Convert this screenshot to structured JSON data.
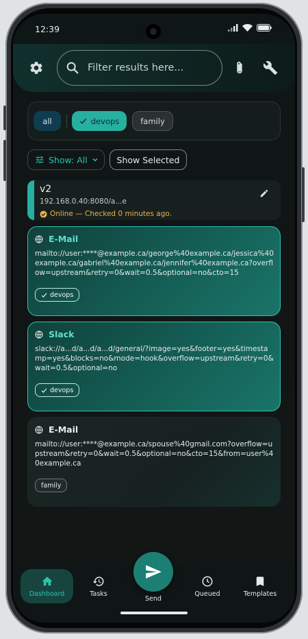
{
  "status_bar": {
    "time": "12:39"
  },
  "header": {
    "settings_icon": "gear-icon",
    "search": {
      "placeholder": "Filter results here...",
      "value": ""
    },
    "attach_icon": "paperclip-icon",
    "tools_icon": "wrench-icon"
  },
  "tag_filters": [
    {
      "label": "all",
      "selected": false
    },
    {
      "label": "devops",
      "selected": true
    },
    {
      "label": "family",
      "selected": false
    }
  ],
  "filter_bar": {
    "show_label": "Show: All",
    "show_selected_label": "Show Selected"
  },
  "host": {
    "title": "v2",
    "url": "192.168.0.40:8080/a...e",
    "status": "Online — Checked 0 minutes ago."
  },
  "cards": [
    {
      "title": "E-Mail",
      "url": "mailto://user:****@example.ca/george%40example.ca/jessica%40example.ca/gabriel%40example.ca/jennifer%40example.ca?overflow=upstream&retry=0&wait=0.5&optional=no&cto=15",
      "tag": "devops",
      "selected": true
    },
    {
      "title": "Slack",
      "url": "slack://a...d/a...d/a...d/general/?image=yes&footer=yes&timestamp=yes&blocks=no&mode=hook&overflow=upstream&retry=0&wait=0.5&optional=no",
      "tag": "devops",
      "selected": true
    },
    {
      "title": "E-Mail",
      "url": "mailto://user:****@example.ca/spouse%40gmail.com?overflow=upstream&retry=0&wait=0.5&optional=no&cto=15&from=user%40example.ca",
      "tag": "family",
      "selected": false
    }
  ],
  "bottom_nav": {
    "dashboard": "Dashboard",
    "tasks": "Tasks",
    "send": "Send",
    "queued": "Queued",
    "templates": "Templates"
  },
  "colors": {
    "accent": "#2fc2b0",
    "chip_selected": "#27b0a0",
    "status_ok": "#e7b24a"
  }
}
